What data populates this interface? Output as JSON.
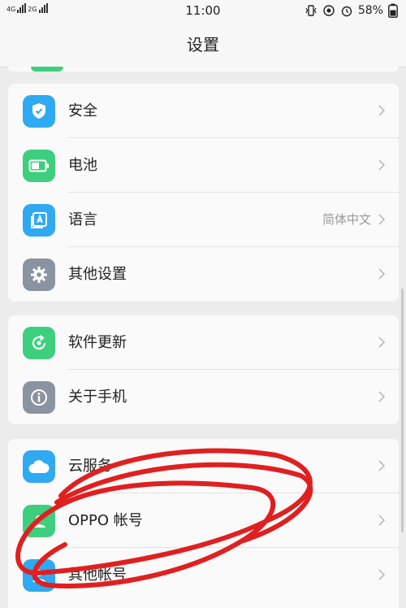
{
  "status": {
    "net1": "4G",
    "net2": "2G",
    "time": "11:00",
    "battery": "58%"
  },
  "header": {
    "title": "设置"
  },
  "sections": [
    {
      "items": [
        {
          "label": "安全",
          "icon": "shield-icon",
          "color": "#2fa9f2"
        },
        {
          "label": "电池",
          "icon": "battery-icon",
          "color": "#3ecf7e"
        },
        {
          "label": "语言",
          "icon": "language-icon",
          "color": "#2fa9f2",
          "value": "简体中文"
        },
        {
          "label": "其他设置",
          "icon": "gear-icon",
          "color": "#8a93a0"
        }
      ]
    },
    {
      "items": [
        {
          "label": "软件更新",
          "icon": "refresh-icon",
          "color": "#3ecf7e"
        },
        {
          "label": "关于手机",
          "icon": "info-icon",
          "color": "#8a93a0"
        }
      ]
    },
    {
      "items": [
        {
          "label": "云服务",
          "icon": "cloud-icon",
          "color": "#2fa9f2"
        },
        {
          "label": "OPPO 帐号",
          "icon": "account-icon",
          "color": "#3ecf7e"
        },
        {
          "label": "其他帐号",
          "icon": "user-icon",
          "color": "#2fa9f2"
        }
      ]
    }
  ],
  "annotation": {
    "color": "#e02020"
  }
}
